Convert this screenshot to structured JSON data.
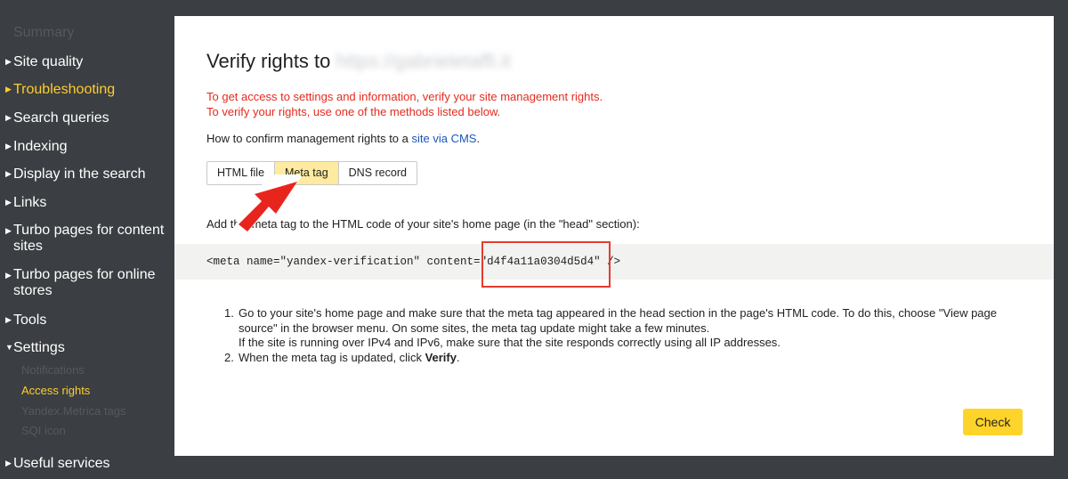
{
  "sidebar": {
    "summary": "Summary",
    "site_quality": "Site quality",
    "troubleshooting": "Troubleshooting",
    "search_queries": "Search queries",
    "indexing": "Indexing",
    "display_in_search": "Display in the search",
    "links": "Links",
    "turbo_content": "Turbo pages for content sites",
    "turbo_stores": "Turbo pages for online stores",
    "tools": "Tools",
    "settings": "Settings",
    "settings_items": [
      "Notifications",
      "Access rights",
      "Yandex.Metrica tags",
      "SQI icon"
    ],
    "useful_services": "Useful services"
  },
  "main": {
    "title": "Verify rights to",
    "site_url": "https://gabrieletaffi.it",
    "warning_line1": "To get access to settings and information, verify your site management rights.",
    "warning_line2": "To verify your rights, use one of the methods listed below.",
    "how_prefix": "How to confirm management rights to a ",
    "how_link": "site via CMS",
    "how_suffix": ".",
    "tabs": [
      "HTML file",
      "Meta tag",
      "DNS record"
    ],
    "selected_tab": "Meta tag",
    "add_instruction": "Add this meta tag to the HTML code of your site's home page (in the \"head\" section):",
    "code_prefix": "<meta name=\"yandex-verification\" content=",
    "code_value": "\"d4f4a11a0304d5d4\"",
    "code_suffix": " />",
    "step1_text": "Go to your site's home page and make sure that the meta tag appeared in the head section in the page's HTML code. To do this, choose \"View page source\" in the browser menu. On some sites, the meta tag update might take a few minutes.",
    "step1_extra": "If the site is running over IPv4 and IPv6, make sure that the site responds correctly using all IP addresses.",
    "step2_prefix": "When the meta tag is updated, click ",
    "step2_bold": "Verify",
    "step2_suffix": ".",
    "check_button": "Check"
  },
  "colors": {
    "background": "#3b3e42",
    "accent_yellow": "#fecd2f",
    "warning_red": "#e52a1d",
    "link_blue": "#1b56b8",
    "selected_tab": "#ffeba0",
    "highlight_red": "#e53a2f"
  }
}
